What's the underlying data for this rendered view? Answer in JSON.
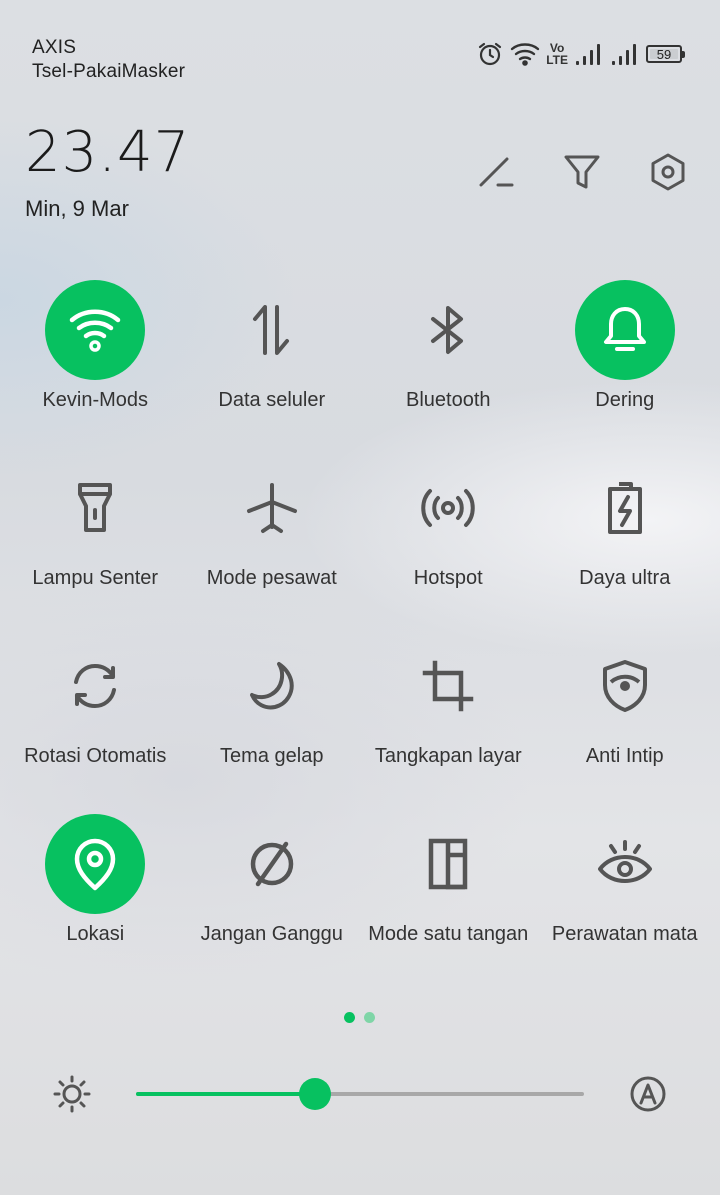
{
  "status_bar": {
    "carrier_1": "AXIS",
    "carrier_2": "Tsel-PakaiMasker",
    "volte_top": "Vo",
    "volte_bottom": "LTE",
    "battery": "59",
    "icons": [
      "alarm-icon",
      "wifi-icon",
      "volte-icon",
      "signal-icon",
      "signal-icon",
      "battery-icon"
    ]
  },
  "header": {
    "time": "23.47",
    "date": "Min, 9 Mar",
    "actions": [
      "edit-icon",
      "filter-icon",
      "settings-icon"
    ]
  },
  "tiles": [
    {
      "label": "Kevin-Mods",
      "icon": "wifi-icon",
      "active": true
    },
    {
      "label": "Data seluler",
      "icon": "mobile-data-icon",
      "active": false
    },
    {
      "label": "Bluetooth",
      "icon": "bluetooth-icon",
      "active": false
    },
    {
      "label": "Dering",
      "icon": "bell-icon",
      "active": true
    },
    {
      "label": "Lampu Senter",
      "icon": "flashlight-icon",
      "active": false
    },
    {
      "label": "Mode pesawat",
      "icon": "airplane-icon",
      "active": false
    },
    {
      "label": "Hotspot",
      "icon": "hotspot-icon",
      "active": false
    },
    {
      "label": "Daya ultra",
      "icon": "battery-saver-icon",
      "active": false
    },
    {
      "label": "Rotasi Otomatis",
      "icon": "rotate-icon",
      "active": false
    },
    {
      "label": "Tema gelap",
      "icon": "moon-icon",
      "active": false
    },
    {
      "label": "Tangkapan layar",
      "icon": "crop-icon",
      "active": false
    },
    {
      "label": "Anti Intip",
      "icon": "shield-eye-icon",
      "active": false
    },
    {
      "label": "Lokasi",
      "icon": "location-icon",
      "active": true
    },
    {
      "label": "Jangan Ganggu",
      "icon": "do-not-disturb-icon",
      "active": false
    },
    {
      "label": "Mode satu tangan",
      "icon": "one-hand-icon",
      "active": false
    },
    {
      "label": "Perawatan mata",
      "icon": "eye-icon",
      "active": false
    }
  ],
  "pager": {
    "pages": 2,
    "current": 1
  },
  "brightness": {
    "level": 0.4,
    "icon": "sun-icon",
    "auto_icon": "auto-brightness-icon"
  },
  "colors": {
    "accent": "#07c160",
    "icon": "#555555"
  }
}
